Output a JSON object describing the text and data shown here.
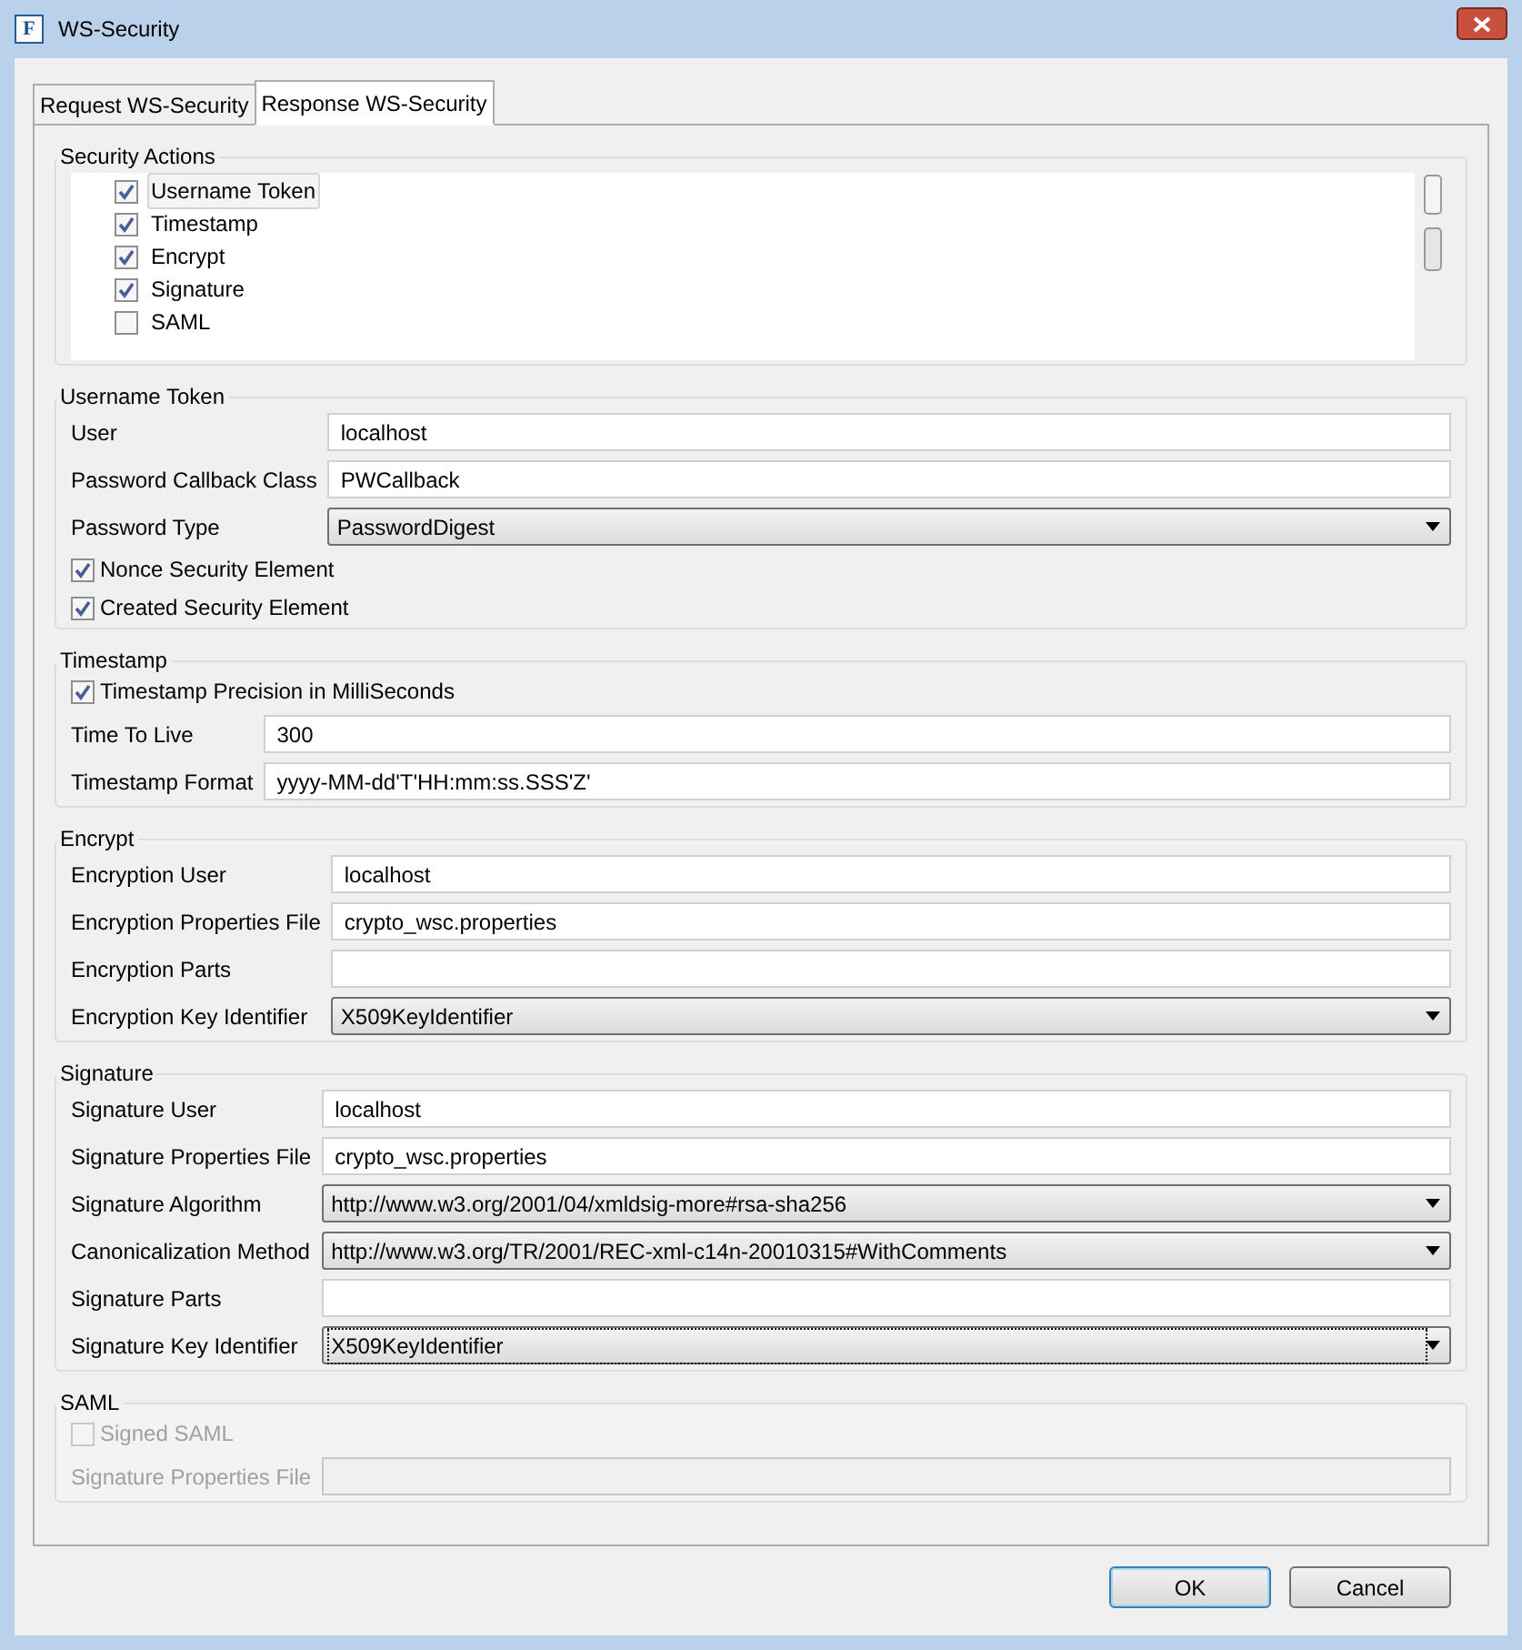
{
  "window": {
    "title": "WS-Security",
    "icon_letter": "F"
  },
  "tabs": [
    {
      "label": "Request WS-Security",
      "selected": false
    },
    {
      "label": "Response WS-Security",
      "selected": true
    }
  ],
  "security_actions": {
    "title": "Security Actions",
    "items": [
      {
        "label": "Username Token",
        "checked": true,
        "focused": true
      },
      {
        "label": "Timestamp",
        "checked": true,
        "focused": false
      },
      {
        "label": "Encrypt",
        "checked": true,
        "focused": false
      },
      {
        "label": "Signature",
        "checked": true,
        "focused": false
      },
      {
        "label": "SAML",
        "checked": false,
        "focused": false
      }
    ]
  },
  "sections": [
    {
      "title": "Username Token",
      "disabled": false,
      "rows": [
        {
          "kind": "text",
          "label": "User",
          "value": "localhost"
        },
        {
          "kind": "text",
          "label": "Password Callback Class",
          "value": "PWCallback"
        },
        {
          "kind": "select",
          "label": "Password Type",
          "value": "PasswordDigest",
          "focused": false
        },
        {
          "kind": "checkbox",
          "label": "Nonce Security Element",
          "checked": true
        },
        {
          "kind": "checkbox",
          "label": "Created Security Element",
          "checked": true
        }
      ]
    },
    {
      "title": "Timestamp",
      "disabled": false,
      "rows": [
        {
          "kind": "checkbox",
          "label": "Timestamp Precision in MilliSeconds",
          "checked": true
        },
        {
          "kind": "text",
          "label": "Time To Live",
          "value": "300"
        },
        {
          "kind": "text",
          "label": "Timestamp Format",
          "value": "yyyy-MM-dd'T'HH:mm:ss.SSS'Z'"
        }
      ]
    },
    {
      "title": "Encrypt",
      "disabled": false,
      "rows": [
        {
          "kind": "text",
          "label": "Encryption User",
          "value": "localhost"
        },
        {
          "kind": "text",
          "label": "Encryption Properties File",
          "value": "crypto_wsc.properties"
        },
        {
          "kind": "text",
          "label": "Encryption Parts"
        },
        {
          "kind": "select",
          "label": "Encryption Key Identifier",
          "value": "X509KeyIdentifier",
          "focused": false
        }
      ]
    },
    {
      "title": "Signature",
      "disabled": false,
      "rows": [
        {
          "kind": "text",
          "label": "Signature User",
          "value": "localhost"
        },
        {
          "kind": "text",
          "label": "Signature Properties File",
          "value": "crypto_wsc.properties"
        },
        {
          "kind": "select",
          "label": "Signature Algorithm",
          "value": "http://www.w3.org/2001/04/xmldsig-more#rsa-sha256",
          "focused": false
        },
        {
          "kind": "select",
          "label": "Canonicalization Method",
          "value": "http://www.w3.org/TR/2001/REC-xml-c14n-20010315#WithComments",
          "focused": false
        },
        {
          "kind": "text",
          "label": "Signature Parts"
        },
        {
          "kind": "select",
          "label": "Signature Key Identifier",
          "value": "X509KeyIdentifier",
          "focused": true
        }
      ]
    },
    {
      "title": "SAML",
      "disabled": true,
      "rows": [
        {
          "kind": "checkbox",
          "label": "Signed SAML",
          "checked": false
        },
        {
          "kind": "text",
          "label": "Signature Properties File"
        }
      ]
    }
  ],
  "buttons": [
    {
      "label": "OK",
      "default": true
    },
    {
      "label": "Cancel",
      "default": false
    }
  ]
}
